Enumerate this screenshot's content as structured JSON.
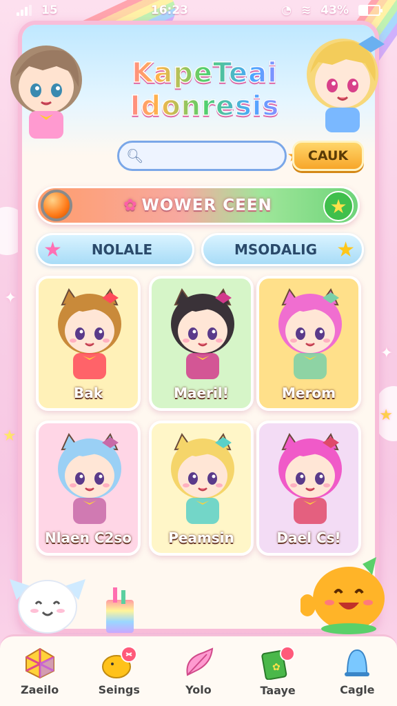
{
  "status_bar": {
    "left_text": "15",
    "time": "16:23",
    "battery": "43%",
    "battery_level": 0.43
  },
  "app": {
    "title_line1": "KapeTeai",
    "title_line2": "Idonresis"
  },
  "search": {
    "placeholder": "",
    "button_label": "CAUK"
  },
  "banner": {
    "label": "WOWER CEEN"
  },
  "pills": [
    {
      "label": "NOLALE"
    },
    {
      "label": "MSODALIG"
    }
  ],
  "characters": [
    {
      "name": "Bak",
      "bg": "#fff1b8",
      "hair": "#c98a3a",
      "accent": "#ff4a5a"
    },
    {
      "name": "Maeril!",
      "bg": "#d6f5c8",
      "hair": "#3a3238",
      "accent": "#d23a8c"
    },
    {
      "name": "Merom",
      "bg": "#ffe08a",
      "hair": "#f06ed0",
      "accent": "#7ad0a8"
    },
    {
      "name": "Nlaen C2so",
      "bg": "#ffd6e6",
      "hair": "#9ad0f5",
      "accent": "#c86aa8"
    },
    {
      "name": "Peamsin",
      "bg": "#fff6c8",
      "hair": "#f5d56a",
      "accent": "#5ad0c8"
    },
    {
      "name": "Dael Cs!",
      "bg": "#f3dcf5",
      "hair": "#f05ac8",
      "accent": "#e04a6a"
    }
  ],
  "bottom_nav": [
    {
      "label": "Zaeilo",
      "icon": "gift-box-icon"
    },
    {
      "label": "Seings",
      "icon": "duck-icon"
    },
    {
      "label": "Yolo",
      "icon": "feather-icon"
    },
    {
      "label": "Taaye",
      "icon": "cards-icon"
    },
    {
      "label": "Cagle",
      "icon": "bell-icon"
    }
  ]
}
